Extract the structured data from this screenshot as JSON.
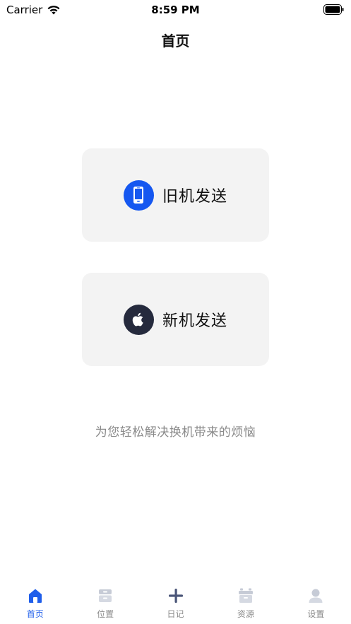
{
  "status_bar": {
    "carrier": "Carrier",
    "time": "8:59 PM"
  },
  "nav": {
    "title": "首页"
  },
  "cards": {
    "old_device": {
      "label": "旧机发送",
      "icon": "phone-icon",
      "color": "#1557f0"
    },
    "new_device": {
      "label": "新机发送",
      "icon": "apple-icon",
      "color": "#252a3d"
    }
  },
  "tagline": "为您轻松解决换机带来的烦恼",
  "tab_bar": {
    "items": [
      {
        "label": "首页",
        "icon": "home-icon",
        "active": true
      },
      {
        "label": "位置",
        "icon": "box-icon",
        "active": false
      },
      {
        "label": "日记",
        "icon": "plus-icon",
        "active": false
      },
      {
        "label": "资源",
        "icon": "archive-icon",
        "active": false
      },
      {
        "label": "设置",
        "icon": "user-icon",
        "active": false
      }
    ]
  },
  "colors": {
    "accent": "#1f5eea",
    "card_bg": "#f3f3f3",
    "inactive_text": "#8a8a8a"
  }
}
